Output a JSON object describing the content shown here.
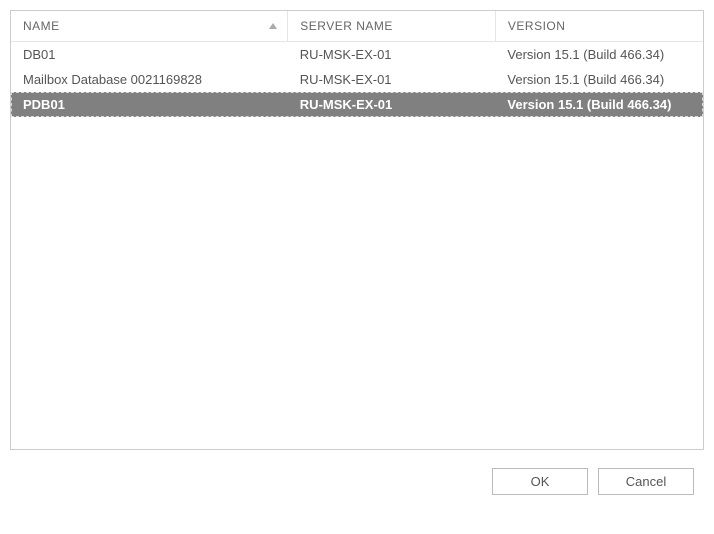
{
  "table": {
    "headers": {
      "name": "NAME",
      "server": "SERVER NAME",
      "version": "VERSION"
    },
    "rows": [
      {
        "name": "DB01",
        "server": "RU-MSK-EX-01",
        "version": "Version 15.1 (Build 466.34)",
        "selected": false
      },
      {
        "name": "Mailbox Database 0021169828",
        "server": "RU-MSK-EX-01",
        "version": "Version 15.1 (Build 466.34)",
        "selected": false
      },
      {
        "name": "PDB01",
        "server": "RU-MSK-EX-01",
        "version": "Version 15.1 (Build 466.34)",
        "selected": true
      }
    ]
  },
  "buttons": {
    "ok": "OK",
    "cancel": "Cancel"
  }
}
